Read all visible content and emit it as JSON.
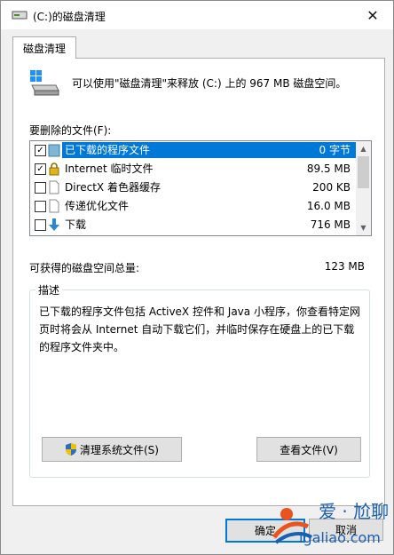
{
  "window": {
    "title": "(C:)的磁盘清理",
    "close": "✕"
  },
  "tab": {
    "label": "磁盘清理"
  },
  "info": {
    "text": "可以使用\"磁盘清理\"来释放  (C:) 上的 967 MB 磁盘空间。"
  },
  "files_label": "要删除的文件(F):",
  "files": [
    {
      "name": "已下载的程序文件",
      "size": "0 字节",
      "checked": true,
      "selected": true,
      "icon": "folder-icon"
    },
    {
      "name": "Internet 临时文件",
      "size": "89.5 MB",
      "checked": true,
      "selected": false,
      "icon": "lock-icon"
    },
    {
      "name": "DirectX 着色器缓存",
      "size": "200 KB",
      "checked": false,
      "selected": false,
      "icon": "document-icon"
    },
    {
      "name": "传递优化文件",
      "size": "16.0 MB",
      "checked": false,
      "selected": false,
      "icon": "document-icon"
    },
    {
      "name": "下载",
      "size": "716 MB",
      "checked": false,
      "selected": false,
      "icon": "download-arrow-icon"
    }
  ],
  "total": {
    "label": "可获得的磁盘空间总量:",
    "value": "123 MB"
  },
  "description": {
    "title": "描述",
    "text": "已下载的程序文件包括 ActiveX 控件和 Java 小程序，你查看特定网页时将会从 Internet 自动下载它们，并临时保存在硬盘上的已下载的程序文件夹中。"
  },
  "buttons": {
    "clean_system": "清理系统文件(S)",
    "view_files": "查看文件(V)",
    "ok": "确定",
    "cancel": "取消"
  },
  "watermark": {
    "brand": "爱 · 尬聊",
    "site": "igaliao.com"
  },
  "colors": {
    "accent": "#0078d7",
    "selection": "#0078d7",
    "window_bg": "#f0f0f0",
    "watermark": "#1a5fb4"
  }
}
